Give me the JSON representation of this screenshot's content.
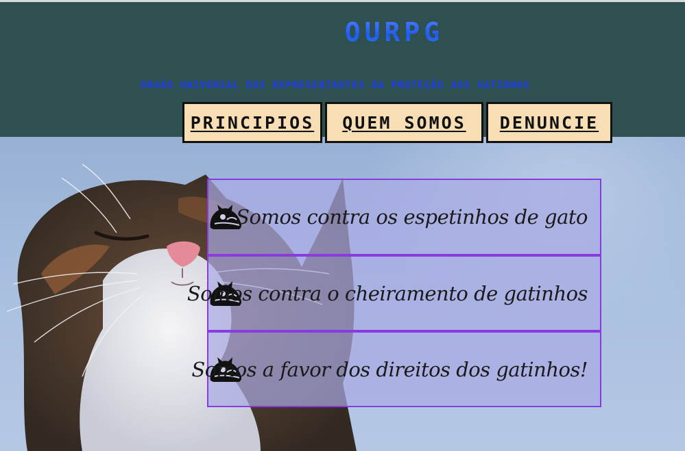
{
  "header": {
    "title": "OURPG",
    "subtitle": "ORGÃO UNIVERSAL DOS REPRESENTANTES DA PROTEÇÃO AOS GATINHOS",
    "background_color": "#2f5050",
    "title_color": "#3b6bff",
    "subtitle_color": "#1d3cf2"
  },
  "nav": {
    "items": [
      {
        "label": "PRINCIPIOS"
      },
      {
        "label": "QUEM SOMOS"
      },
      {
        "label": "DENUNCIE"
      }
    ],
    "button_color": "#f7deb5"
  },
  "principles": {
    "items": [
      {
        "icon": "cat-silhouette-icon",
        "text": "Somos contra os espetinhos de gato"
      },
      {
        "icon": "cat-silhouette-icon",
        "text": "Somos contra o cheiramento de gatinhos"
      },
      {
        "icon": "cat-silhouette-icon",
        "text": "Somos a favor dos direitos dos gatinhos!"
      }
    ],
    "border_color": "#8a3be0"
  },
  "background_image": {
    "subject": "cat-photo"
  }
}
